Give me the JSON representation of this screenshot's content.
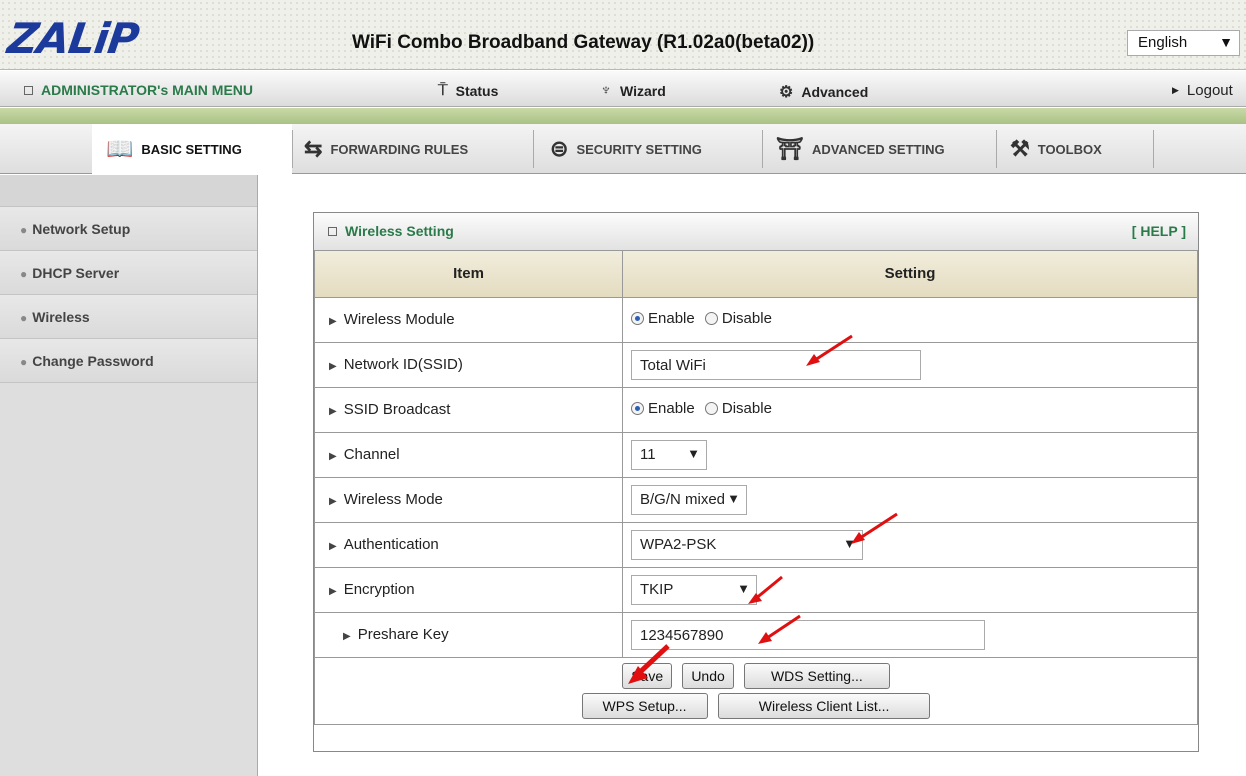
{
  "header": {
    "logo": "ZALiP",
    "title": "WiFi Combo Broadband Gateway  (R1.02a0(beta02))",
    "language": "English"
  },
  "menubar": {
    "admin": "ADMINISTRATOR's MAIN MENU",
    "status": "Status",
    "wizard": "Wizard",
    "advanced": "Advanced",
    "logout": "Logout"
  },
  "tabs": [
    {
      "label": "BASIC SETTING",
      "icon": "book-icon"
    },
    {
      "label": "FORWARDING RULES",
      "icon": "forwarding-icon"
    },
    {
      "label": "SECURITY SETTING",
      "icon": "security-icon"
    },
    {
      "label": "ADVANCED SETTING",
      "icon": "advanced-icon"
    },
    {
      "label": "TOOLBOX",
      "icon": "toolbox-icon"
    }
  ],
  "sidebar": {
    "items": [
      {
        "label": "Network Setup"
      },
      {
        "label": "DHCP Server"
      },
      {
        "label": "Wireless"
      },
      {
        "label": "Change Password"
      }
    ]
  },
  "panel": {
    "title": "Wireless Setting",
    "help": "[ HELP ]",
    "col_item": "Item",
    "col_setting": "Setting",
    "rows": {
      "wireless_module": {
        "label": "Wireless Module",
        "enable": "Enable",
        "disable": "Disable"
      },
      "ssid": {
        "label": "Network ID(SSID)",
        "value": "Total WiFi"
      },
      "ssid_broadcast": {
        "label": "SSID Broadcast",
        "enable": "Enable",
        "disable": "Disable"
      },
      "channel": {
        "label": "Channel",
        "value": "11"
      },
      "wireless_mode": {
        "label": "Wireless Mode",
        "value": "B/G/N mixed"
      },
      "authentication": {
        "label": "Authentication",
        "value": "WPA2-PSK"
      },
      "encryption": {
        "label": "Encryption",
        "value": "TKIP"
      },
      "preshare_key": {
        "label": "Preshare Key",
        "value": "1234567890"
      }
    },
    "buttons": {
      "save": "Save",
      "undo": "Undo",
      "wds": "WDS Setting...",
      "wps": "WPS Setup...",
      "client_list": "Wireless Client List..."
    }
  },
  "colors": {
    "logo": "#1c3a9c",
    "menu_green": "#2a7a4a",
    "annotation_red": "#e01010"
  }
}
